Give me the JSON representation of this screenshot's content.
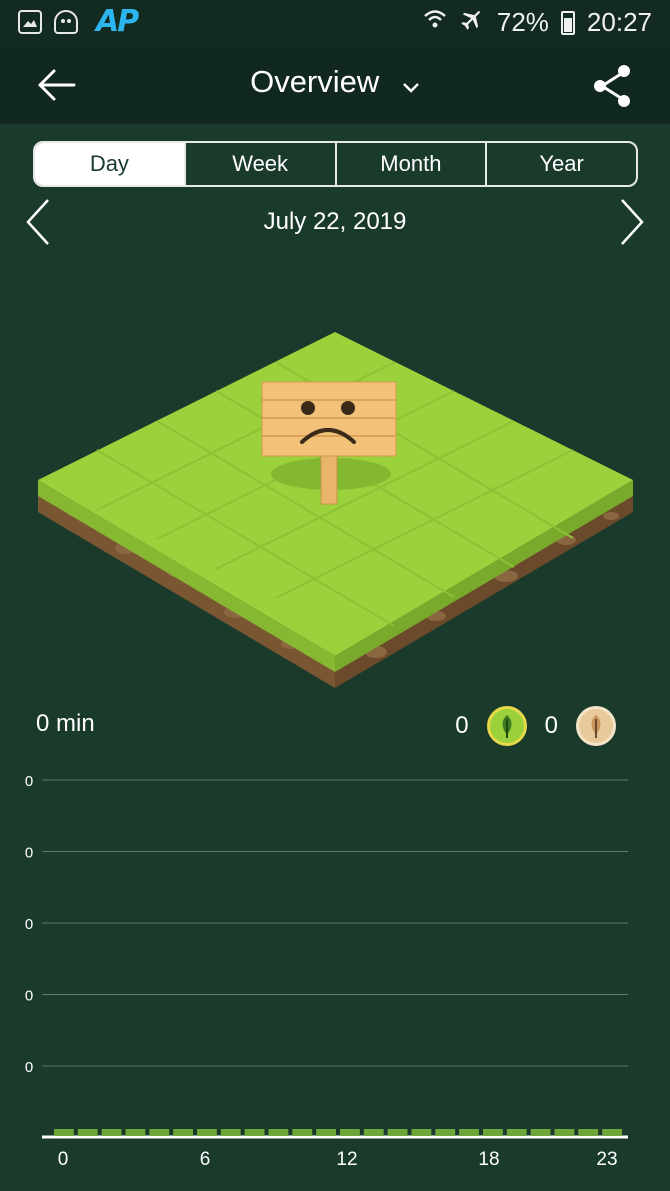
{
  "status_bar": {
    "icons": [
      "gallery-icon",
      "robot-icon",
      "ap-logo",
      "wifi-icon",
      "airplane-icon",
      "battery-icon"
    ],
    "logo_text": "AP",
    "battery": "72%",
    "time": "20:27"
  },
  "header": {
    "title": "Overview"
  },
  "tabs": [
    {
      "label": "Day",
      "active": true
    },
    {
      "label": "Week",
      "active": false
    },
    {
      "label": "Month",
      "active": false
    },
    {
      "label": "Year",
      "active": false
    }
  ],
  "date": "July 22, 2019",
  "summary": {
    "focus_time": "0 min",
    "healthy_trees": "0",
    "dead_trees": "0"
  },
  "colors": {
    "background": "#1a3a2c",
    "header": "#112820",
    "bar": "#6fa63a",
    "grass": "#9bd13b",
    "soil": "#7a5632"
  },
  "chart_data": {
    "type": "bar",
    "y_tick_labels": [
      "0",
      "0",
      "0",
      "0",
      "0"
    ],
    "x_tick_labels": [
      "0",
      "6",
      "12",
      "18",
      "23"
    ],
    "x": [
      0,
      1,
      2,
      3,
      4,
      5,
      6,
      7,
      8,
      9,
      10,
      11,
      12,
      13,
      14,
      15,
      16,
      17,
      18,
      19,
      20,
      21,
      22,
      23
    ],
    "values": [
      0,
      0,
      0,
      0,
      0,
      0,
      0,
      0,
      0,
      0,
      0,
      0,
      0,
      0,
      0,
      0,
      0,
      0,
      0,
      0,
      0,
      0,
      0,
      0
    ],
    "grid": true
  }
}
